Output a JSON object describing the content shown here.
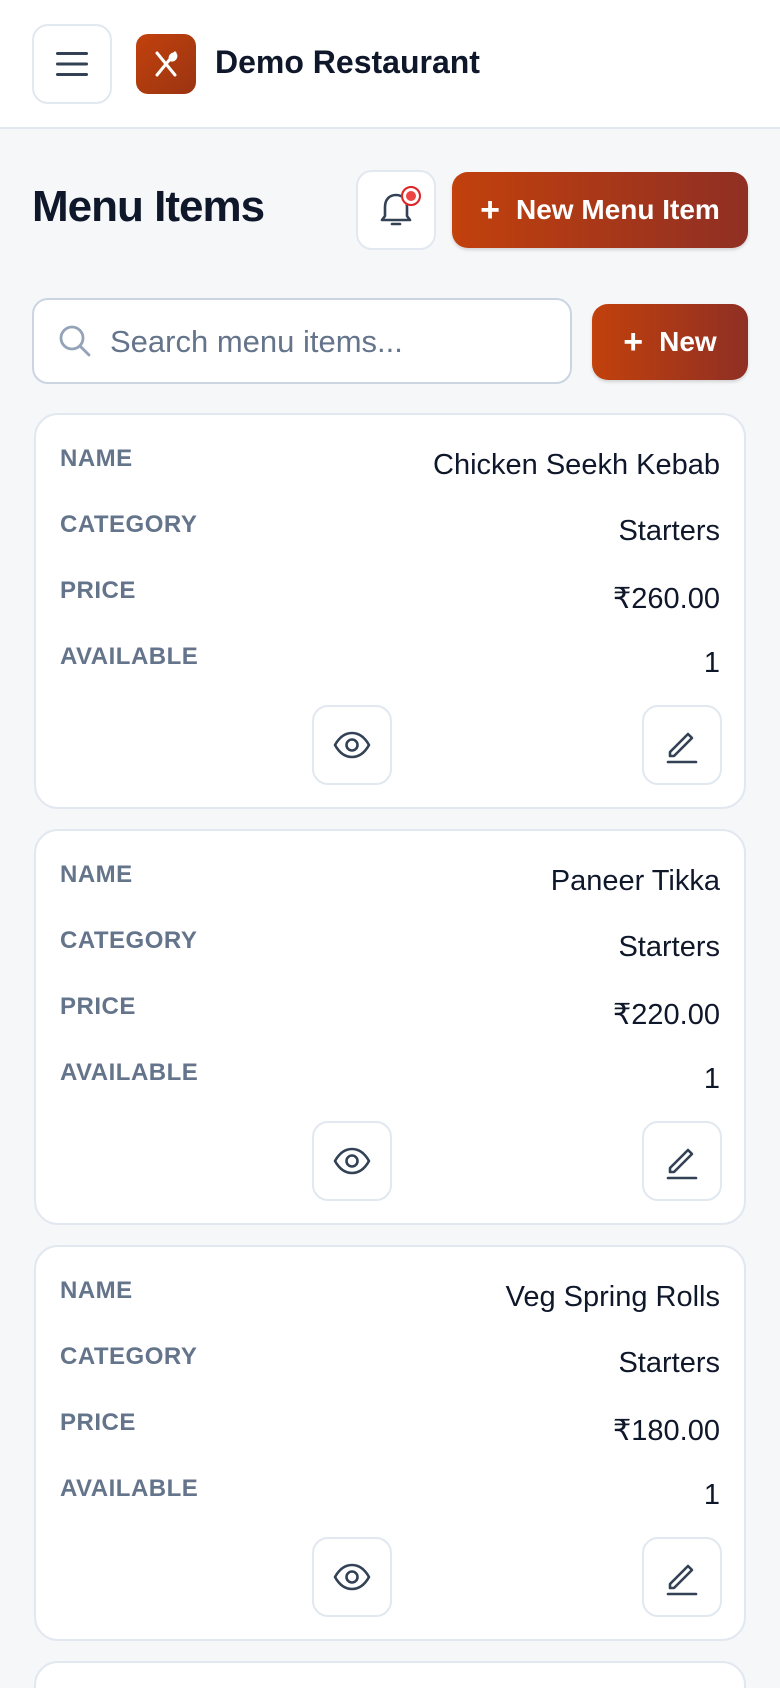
{
  "header": {
    "brand": "Demo Restaurant",
    "icons": {
      "menu": "hamburger-icon",
      "logo": "utensils-icon"
    }
  },
  "page": {
    "title": "Menu Items",
    "new_menu_item_label": "New Menu Item",
    "notification_icon": "bell-icon"
  },
  "search": {
    "placeholder": "Search menu items...",
    "value": "",
    "new_label": "New"
  },
  "labels": {
    "name": "NAME",
    "category": "CATEGORY",
    "price": "PRICE",
    "available": "AVAILABLE"
  },
  "items": [
    {
      "name": "Chicken Seekh Kebab",
      "category": "Starters",
      "price": "₹260.00",
      "available": "1"
    },
    {
      "name": "Paneer Tikka",
      "category": "Starters",
      "price": "₹220.00",
      "available": "1"
    },
    {
      "name": "Veg Spring Rolls",
      "category": "Starters",
      "price": "₹180.00",
      "available": "1"
    }
  ],
  "colors": {
    "accent": "#c2410c",
    "accent_dark": "#8f2f24",
    "notification": "#ef4444"
  }
}
